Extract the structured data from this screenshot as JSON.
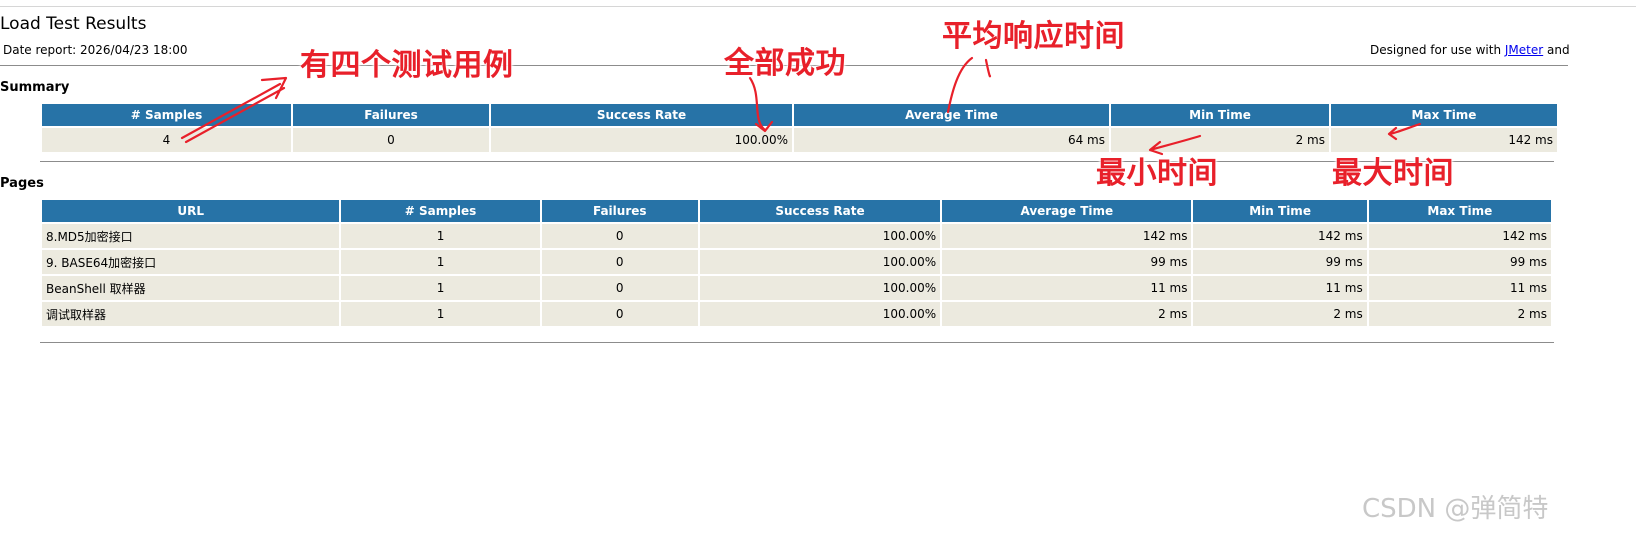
{
  "header": {
    "title": "Load Test Results",
    "date_report": "Date report: 2026/04/23 18:00",
    "designed_prefix": "Designed for use with ",
    "jmeter_link": "JMeter",
    "designed_suffix": " and"
  },
  "summary": {
    "title": "Summary",
    "columns": [
      "# Samples",
      "Failures",
      "Success Rate",
      "Average Time",
      "Min Time",
      "Max Time"
    ],
    "row": {
      "samples": "4",
      "failures": "0",
      "success_rate": "100.00%",
      "average_time": "64 ms",
      "min_time": "2 ms",
      "max_time": "142 ms"
    }
  },
  "pages": {
    "title": "Pages",
    "columns": [
      "URL",
      "# Samples",
      "Failures",
      "Success Rate",
      "Average Time",
      "Min Time",
      "Max Time"
    ],
    "rows": [
      {
        "url": "8.MD5加密接口",
        "samples": "1",
        "failures": "0",
        "success_rate": "100.00%",
        "average_time": "142 ms",
        "min_time": "142 ms",
        "max_time": "142 ms"
      },
      {
        "url": "9. BASE64加密接口",
        "samples": "1",
        "failures": "0",
        "success_rate": "100.00%",
        "average_time": "99 ms",
        "min_time": "99 ms",
        "max_time": "99 ms"
      },
      {
        "url": "BeanShell 取样器",
        "samples": "1",
        "failures": "0",
        "success_rate": "100.00%",
        "average_time": "11 ms",
        "min_time": "11 ms",
        "max_time": "11 ms"
      },
      {
        "url": "调试取样器",
        "samples": "1",
        "failures": "0",
        "success_rate": "100.00%",
        "average_time": "2 ms",
        "min_time": "2 ms",
        "max_time": "2 ms"
      }
    ]
  },
  "annotations": {
    "four_cases": "有四个测试用例",
    "all_success": "全部成功",
    "avg_response": "平均响应时间",
    "min_time": "最小时间",
    "max_time": "最大时间",
    "color": "#e8202a"
  },
  "watermark": "CSDN @弹简特",
  "colors": {
    "header_bg": "#2773a7",
    "cell_bg": "#eceadf",
    "link": "#0000ee"
  }
}
